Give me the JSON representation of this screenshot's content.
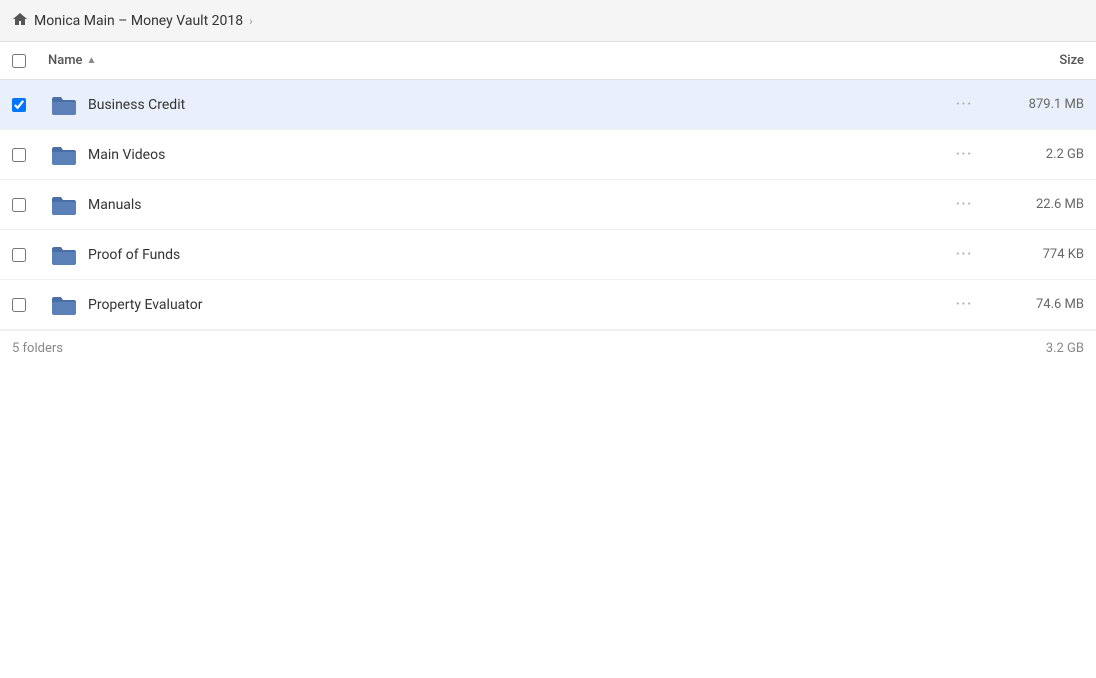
{
  "breadcrumb": {
    "home_icon": "home",
    "title": "Monica Main – Money Vault 2018",
    "chevron": "›"
  },
  "table_header": {
    "name_label": "Name",
    "sort_icon": "▲",
    "size_label": "Size"
  },
  "rows": [
    {
      "id": "business-credit",
      "name": "Business Credit",
      "size": "879.1 MB",
      "selected": true
    },
    {
      "id": "main-videos",
      "name": "Main Videos",
      "size": "2.2 GB",
      "selected": false
    },
    {
      "id": "manuals",
      "name": "Manuals",
      "size": "22.6 MB",
      "selected": false
    },
    {
      "id": "proof-of-funds",
      "name": "Proof of Funds",
      "size": "774 KB",
      "selected": false
    },
    {
      "id": "property-evaluator",
      "name": "Property Evaluator",
      "size": "74.6 MB",
      "selected": false
    }
  ],
  "footer": {
    "count_label": "5 folders",
    "total_size": "3.2 GB"
  },
  "more_icon": "•••"
}
